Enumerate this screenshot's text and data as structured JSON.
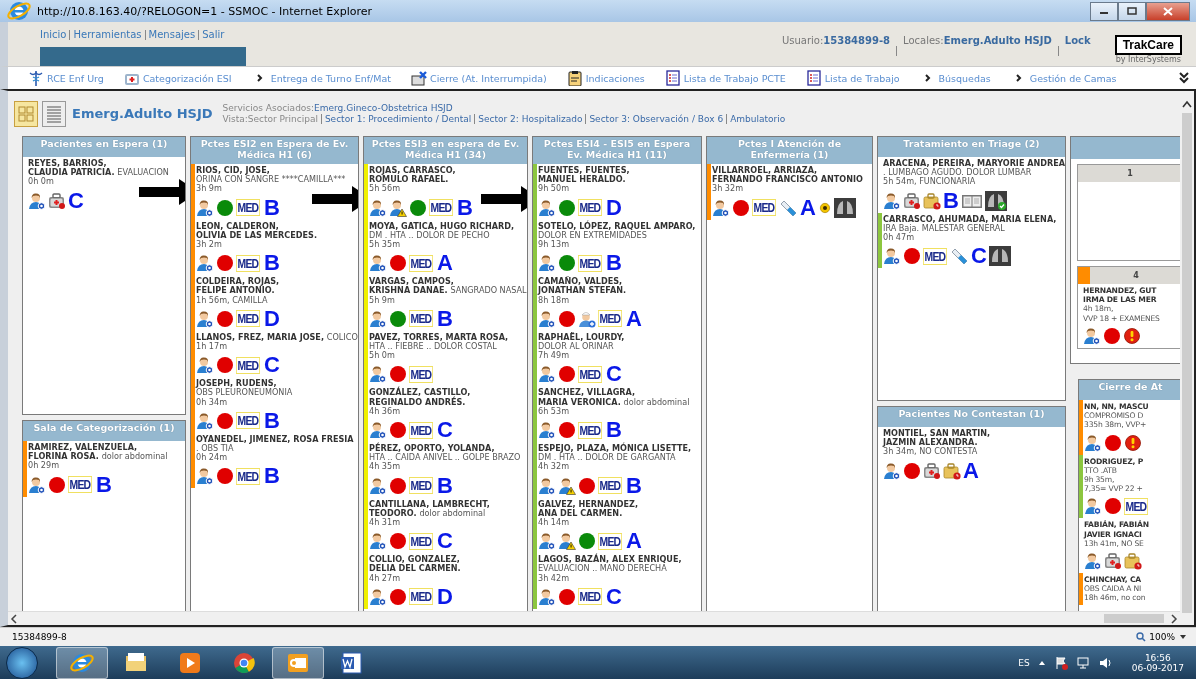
{
  "browser": {
    "title": "http://10.8.163.40/?RELOGON=1 - SSMOC - Internet Explorer",
    "status": "15384899-8",
    "zoom": "100%"
  },
  "header": {
    "links": [
      "Inicio",
      "Herramientas",
      "Mensajes",
      "Salir"
    ],
    "user_label": "Usuario:",
    "user": "15384899-8",
    "locale_label": "Locales:",
    "locale": "Emerg.Adulto HSJD",
    "lock": "Lock",
    "logo": "TrakCare",
    "logo_by": "by InterSystems"
  },
  "menu": [
    {
      "label": "RCE Enf Urg",
      "kind": "caduceus"
    },
    {
      "label": "Categorización ESI",
      "kind": "kit"
    },
    {
      "label": "Entrega de Turno Enf/Mat",
      "kind": "chevron"
    },
    {
      "label": "Cierre (At. Interrumpida)",
      "kind": "folder"
    },
    {
      "label": "Indicaciones",
      "kind": "clipboard"
    },
    {
      "label": "Lista de Trabajo PCTE",
      "kind": "list"
    },
    {
      "label": "Lista de Trabajo",
      "kind": "list"
    },
    {
      "label": "Búsquedas",
      "kind": "chevron"
    },
    {
      "label": "Gestión de Camas",
      "kind": "chevron"
    }
  ],
  "location": {
    "view_toggle": [
      {
        "kind": "grid",
        "selected": true
      },
      {
        "kind": "list",
        "selected": false
      }
    ],
    "title": "Emerg.Adulto HSJD",
    "services_label": "Servicios Asociados:",
    "services": "Emerg.Gineco-Obstetrica HSJD",
    "view_label": "Vista:Sector Principal",
    "sectors": [
      "Sector 1: Procedimiento / Dental",
      "Sector 2: Hospitalizado",
      "Sector 3: Observación / Box 6",
      "Ambulatorio"
    ]
  },
  "columns": [
    {
      "panels": [
        {
          "kind": "patients",
          "title": "Pacientes en Espera (1)",
          "arrow": true,
          "patients": [
            {
              "lines": [
                {
                  "kind": "name",
                  "text": "REYES, BARRIOS,"
                },
                {
                  "kind": "name",
                  "text": "CLAUDIA PATRICIA.",
                  "note": "EVALUACION"
                },
                {
                  "kind": "time",
                  "text": "0h 0m"
                }
              ],
              "icons": [
                {
                  "kind": "nurse"
                },
                {
                  "kind": "kit"
                },
                {
                  "kind": "grade",
                  "label": "C"
                }
              ]
            }
          ]
        },
        {
          "kind": "patients",
          "title": "Sala de Categorización (1)",
          "arrow": false,
          "patients": [
            {
              "color": "#ff8c00",
              "lines": [
                {
                  "kind": "name",
                  "text": "RAMIREZ, VALENZUELA,"
                },
                {
                  "kind": "name",
                  "text": "FLORINA ROSA.",
                  "note": "dolor abdominal"
                },
                {
                  "kind": "time",
                  "text": "0h 29m"
                }
              ],
              "icons": [
                {
                  "kind": "nurse"
                },
                {
                  "kind": "dot",
                  "color": "#e00000"
                },
                {
                  "kind": "med",
                  "label": "MED"
                },
                {
                  "kind": "grade",
                  "label": "B"
                }
              ]
            }
          ]
        }
      ]
    },
    {
      "panels": [
        {
          "kind": "patients",
          "title": "Pctes ESI2 en Espera de Ev. Médica H1 (6)",
          "arrow": true,
          "patients": [
            {
              "color": "#ff8c00",
              "lines": [
                {
                  "kind": "name",
                  "text": "RIOS, CID, JOSE,"
                },
                {
                  "kind": "note",
                  "text": "ORINA CON SANGRE ****CAMILLA***"
                },
                {
                  "kind": "time",
                  "text": "3h 9m"
                }
              ],
              "icons": [
                {
                  "kind": "nurse"
                },
                {
                  "kind": "dot",
                  "color": "#0a8a0a"
                },
                {
                  "kind": "med",
                  "label": "MED"
                },
                {
                  "kind": "grade",
                  "label": "B"
                }
              ]
            },
            {
              "color": "#ff8c00",
              "lines": [
                {
                  "kind": "name",
                  "text": "LEON, CALDERON,"
                },
                {
                  "kind": "name",
                  "text": "OLIVIA DE LAS MERCEDES."
                },
                {
                  "kind": "time",
                  "text": "3h 2m"
                }
              ],
              "icons": [
                {
                  "kind": "nurse"
                },
                {
                  "kind": "dot",
                  "color": "#e00000"
                },
                {
                  "kind": "med",
                  "label": "MED"
                },
                {
                  "kind": "grade",
                  "label": "B"
                }
              ]
            },
            {
              "color": "#ff8c00",
              "lines": [
                {
                  "kind": "name",
                  "text": "COLDEIRA, ROJAS,"
                },
                {
                  "kind": "name",
                  "text": "FELIPE ANTONIO."
                },
                {
                  "kind": "time",
                  "text": "1h 56m, CAMILLA"
                }
              ],
              "icons": [
                {
                  "kind": "nurse"
                },
                {
                  "kind": "dot",
                  "color": "#e00000"
                },
                {
                  "kind": "med",
                  "label": "MED"
                },
                {
                  "kind": "grade",
                  "label": "D"
                }
              ]
            },
            {
              "color": "#ff8c00",
              "lines": [
                {
                  "kind": "name",
                  "text": "LLANOS, FREZ, MARIA JOSE,",
                  "note": "COLICO"
                },
                {
                  "kind": "time",
                  "text": "1h 17m"
                }
              ],
              "icons": [
                {
                  "kind": "nurse"
                },
                {
                  "kind": "dot",
                  "color": "#e00000"
                },
                {
                  "kind": "med",
                  "label": "MED"
                },
                {
                  "kind": "grade",
                  "label": "C"
                }
              ]
            },
            {
              "color": "#ff8c00",
              "lines": [
                {
                  "kind": "name",
                  "text": "JOSEPH, RUDENS,"
                },
                {
                  "kind": "note",
                  "text": "OBS PLEURONEUMONIA"
                },
                {
                  "kind": "time",
                  "text": "0h 34m"
                }
              ],
              "icons": [
                {
                  "kind": "nurse"
                },
                {
                  "kind": "dot",
                  "color": "#e00000"
                },
                {
                  "kind": "med",
                  "label": "MED"
                },
                {
                  "kind": "grade",
                  "label": "B"
                }
              ]
            },
            {
              "color": "#ff8c00",
              "lines": [
                {
                  "kind": "name",
                  "text": "OYANEDEL, JIMENEZ, ROSA FRESIA"
                },
                {
                  "kind": "note",
                  "text": ". OBS TIA"
                },
                {
                  "kind": "time",
                  "text": "0h 24m"
                }
              ],
              "icons": [
                {
                  "kind": "nurse"
                },
                {
                  "kind": "dot",
                  "color": "#e00000"
                },
                {
                  "kind": "med",
                  "label": "MED"
                },
                {
                  "kind": "grade",
                  "label": "B"
                }
              ]
            }
          ]
        }
      ]
    },
    {
      "panels": [
        {
          "kind": "patients",
          "title": "Pctes ESI3 en espera de Ev. Médica H1 (34)",
          "arrow": true,
          "patients": [
            {
              "color": "#f0f000",
              "lines": [
                {
                  "kind": "name",
                  "text": "ROJAS, CARRASCO,"
                },
                {
                  "kind": "name",
                  "text": "ROMULO RAFAEL."
                },
                {
                  "kind": "time",
                  "text": "5h 56m"
                }
              ],
              "icons": [
                {
                  "kind": "nurse"
                },
                {
                  "kind": "warn"
                },
                {
                  "kind": "dot",
                  "color": "#0a8a0a"
                },
                {
                  "kind": "med",
                  "label": "MED"
                },
                {
                  "kind": "grade",
                  "label": "B"
                }
              ]
            },
            {
              "color": "#f0f000",
              "lines": [
                {
                  "kind": "name",
                  "text": "MOYA, GATICA, HUGO RICHARD,"
                },
                {
                  "kind": "note",
                  "text": "DM . HTA .. DOLOR DE PECHO"
                },
                {
                  "kind": "time",
                  "text": "5h 35m"
                }
              ],
              "icons": [
                {
                  "kind": "nurse"
                },
                {
                  "kind": "dot",
                  "color": "#e00000"
                },
                {
                  "kind": "med",
                  "label": "MED"
                },
                {
                  "kind": "grade",
                  "label": "A"
                }
              ]
            },
            {
              "color": "#f0f000",
              "lines": [
                {
                  "kind": "name",
                  "text": "VARGAS, CAMPOS,"
                },
                {
                  "kind": "name",
                  "text": "KRISHNA DANAE.",
                  "note": "SANGRADO NASAL"
                },
                {
                  "kind": "time",
                  "text": "5h 9m"
                }
              ],
              "icons": [
                {
                  "kind": "nurse"
                },
                {
                  "kind": "dot",
                  "color": "#0a8a0a"
                },
                {
                  "kind": "med",
                  "label": "MED"
                },
                {
                  "kind": "grade",
                  "label": "B"
                }
              ]
            },
            {
              "color": "#f0f000",
              "lines": [
                {
                  "kind": "name",
                  "text": "PAVEZ, TORRES, MARTA ROSA,"
                },
                {
                  "kind": "note",
                  "text": "HTA .. FIEBRE .. DOLOR COSTAL"
                },
                {
                  "kind": "time",
                  "text": "5h 0m"
                }
              ],
              "icons": [
                {
                  "kind": "nurse"
                },
                {
                  "kind": "dot",
                  "color": "#e00000"
                },
                {
                  "kind": "med",
                  "label": "MED"
                }
              ]
            },
            {
              "color": "#f0f000",
              "lines": [
                {
                  "kind": "name",
                  "text": "GONZÁLEZ, CASTILLO,"
                },
                {
                  "kind": "name",
                  "text": "REGINALDO ANDRÉS."
                },
                {
                  "kind": "time",
                  "text": "4h 36m"
                }
              ],
              "icons": [
                {
                  "kind": "nurse"
                },
                {
                  "kind": "dot",
                  "color": "#e00000"
                },
                {
                  "kind": "med",
                  "label": "MED"
                },
                {
                  "kind": "grade",
                  "label": "C"
                }
              ]
            },
            {
              "color": "#f0f000",
              "lines": [
                {
                  "kind": "name",
                  "text": "PÉREZ, OPORTO, YOLANDA,"
                },
                {
                  "kind": "note",
                  "text": "HTA .. CAIDA ANIVEL .. GOLPE BRAZO"
                },
                {
                  "kind": "time",
                  "text": "4h 35m"
                }
              ],
              "icons": [
                {
                  "kind": "nurse"
                },
                {
                  "kind": "dot",
                  "color": "#e00000"
                },
                {
                  "kind": "med",
                  "label": "MED"
                },
                {
                  "kind": "grade",
                  "label": "B"
                }
              ]
            },
            {
              "color": "#f0f000",
              "lines": [
                {
                  "kind": "name",
                  "text": "CANTILLANA, LAMBRECHT,"
                },
                {
                  "kind": "name",
                  "text": "TEODORO.",
                  "note": "dolor abdominal"
                },
                {
                  "kind": "time",
                  "text": "4h 31m"
                }
              ],
              "icons": [
                {
                  "kind": "nurse"
                },
                {
                  "kind": "dot",
                  "color": "#e00000"
                },
                {
                  "kind": "med",
                  "label": "MED"
                },
                {
                  "kind": "grade",
                  "label": "C"
                }
              ]
            },
            {
              "color": "#f0f000",
              "lines": [
                {
                  "kind": "name",
                  "text": "COLLIO, GONZALEZ,"
                },
                {
                  "kind": "name",
                  "text": "DELIA DEL CARMEN."
                },
                {
                  "kind": "time",
                  "text": "4h 27m"
                }
              ],
              "icons": [
                {
                  "kind": "nurse"
                },
                {
                  "kind": "dot",
                  "color": "#e00000"
                },
                {
                  "kind": "med",
                  "label": "MED"
                },
                {
                  "kind": "grade",
                  "label": "D"
                }
              ]
            }
          ]
        }
      ]
    },
    {
      "panels": [
        {
          "kind": "patients",
          "title": "Pctes ESI4 - ESI5 en Espera Ev. Médica H1 (11)",
          "arrow": false,
          "patients": [
            {
              "color": "#8cc63f",
              "lines": [
                {
                  "kind": "name",
                  "text": "FUENTES, FUENTES,"
                },
                {
                  "kind": "name",
                  "text": "MANUEL HERALDO."
                },
                {
                  "kind": "time",
                  "text": "9h 50m"
                }
              ],
              "icons": [
                {
                  "kind": "nurse"
                },
                {
                  "kind": "dot",
                  "color": "#0a8a0a"
                },
                {
                  "kind": "med",
                  "label": "MED"
                },
                {
                  "kind": "grade",
                  "label": "D"
                }
              ]
            },
            {
              "color": "#8cc63f",
              "lines": [
                {
                  "kind": "name",
                  "text": "SOTELO, LÓPEZ, RAQUEL AMPARO,"
                },
                {
                  "kind": "note",
                  "text": "DOLOR EN EXTREMIDADES"
                },
                {
                  "kind": "time",
                  "text": "9h 13m"
                }
              ],
              "icons": [
                {
                  "kind": "nurse"
                },
                {
                  "kind": "dot",
                  "color": "#0a8a0a"
                },
                {
                  "kind": "med",
                  "label": "MED"
                },
                {
                  "kind": "grade",
                  "label": "B"
                }
              ]
            },
            {
              "color": "#8cc63f",
              "lines": [
                {
                  "kind": "name",
                  "text": "CAMAÑO, VALDES,"
                },
                {
                  "kind": "name",
                  "text": "JONATHAN STEFAN."
                },
                {
                  "kind": "time",
                  "text": "8h 18m"
                }
              ],
              "icons": [
                {
                  "kind": "nurse"
                },
                {
                  "kind": "dot",
                  "color": "#e00000"
                },
                {
                  "kind": "doctor"
                },
                {
                  "kind": "med",
                  "label": "MED"
                },
                {
                  "kind": "grade",
                  "label": "A"
                }
              ]
            },
            {
              "color": "#8cc63f",
              "lines": [
                {
                  "kind": "name",
                  "text": "RAPHAËL, LOURDY,"
                },
                {
                  "kind": "note",
                  "text": "DOLOR AL ORINAR"
                },
                {
                  "kind": "time",
                  "text": "7h 49m"
                }
              ],
              "icons": [
                {
                  "kind": "nurse"
                },
                {
                  "kind": "dot",
                  "color": "#e00000"
                },
                {
                  "kind": "med",
                  "label": "MED"
                },
                {
                  "kind": "grade",
                  "label": "C"
                }
              ]
            },
            {
              "color": "#8cc63f",
              "lines": [
                {
                  "kind": "name",
                  "text": "SANCHEZ, VILLAGRA,"
                },
                {
                  "kind": "name",
                  "text": "MARIA VERONICA.",
                  "note": "dolor abdominal"
                },
                {
                  "kind": "time",
                  "text": "6h 53m"
                }
              ],
              "icons": [
                {
                  "kind": "nurse"
                },
                {
                  "kind": "dot",
                  "color": "#e00000"
                },
                {
                  "kind": "med",
                  "label": "MED"
                },
                {
                  "kind": "grade",
                  "label": "B"
                }
              ]
            },
            {
              "color": "#8cc63f",
              "lines": [
                {
                  "kind": "name",
                  "text": "ESPEJO, PLAZA, MÓNICA LISETTE,"
                },
                {
                  "kind": "note",
                  "text": "DM . HTA .. DOLOR DE GARGANTA"
                },
                {
                  "kind": "time",
                  "text": "4h 32m"
                }
              ],
              "icons": [
                {
                  "kind": "nurse"
                },
                {
                  "kind": "warn"
                },
                {
                  "kind": "dot",
                  "color": "#e00000"
                },
                {
                  "kind": "med",
                  "label": "MED"
                },
                {
                  "kind": "grade",
                  "label": "B"
                }
              ]
            },
            {
              "color": "#8cc63f",
              "lines": [
                {
                  "kind": "name",
                  "text": "GALVEZ, HERNANDEZ,"
                },
                {
                  "kind": "name",
                  "text": "ANA DEL CARMEN."
                },
                {
                  "kind": "time",
                  "text": "4h 14m"
                }
              ],
              "icons": [
                {
                  "kind": "nurse"
                },
                {
                  "kind": "warn"
                },
                {
                  "kind": "dot",
                  "color": "#0a8a0a"
                },
                {
                  "kind": "med",
                  "label": "MED"
                },
                {
                  "kind": "grade",
                  "label": "A"
                }
              ]
            },
            {
              "color": "#8cc63f",
              "lines": [
                {
                  "kind": "name",
                  "text": "LAGOS, BAZÁN, ALEX ENRIQUE,"
                },
                {
                  "kind": "note",
                  "text": "EVALUACION .. MANO DERECHA"
                },
                {
                  "kind": "time",
                  "text": "3h 42m"
                }
              ],
              "icons": [
                {
                  "kind": "nurse"
                },
                {
                  "kind": "dot",
                  "color": "#e00000"
                },
                {
                  "kind": "med",
                  "label": "MED"
                },
                {
                  "kind": "grade",
                  "label": "C"
                }
              ]
            }
          ]
        }
      ]
    },
    {
      "panels": [
        {
          "kind": "patients",
          "title": "Pctes I Atención de Enfermería (1)",
          "arrow": false,
          "patients": [
            {
              "color": "#ff8c00",
              "lines": [
                {
                  "kind": "name",
                  "text": "VILLARROEL, ARRIAZA,"
                },
                {
                  "kind": "name",
                  "text": "FERNANDO FRANCISCO ANTONIO"
                },
                {
                  "kind": "time",
                  "text": "3h 32m"
                }
              ],
              "icons": [
                {
                  "kind": "nurse"
                },
                {
                  "kind": "dot",
                  "color": "#e00000"
                },
                {
                  "kind": "med",
                  "label": "MED"
                },
                {
                  "kind": "syringe"
                },
                {
                  "kind": "grade",
                  "label": "A"
                },
                {
                  "kind": "sun"
                },
                {
                  "kind": "xray"
                }
              ]
            }
          ]
        }
      ]
    },
    {
      "panels": [
        {
          "kind": "patients",
          "title": "Tratamiento en Triage (2)",
          "arrow": false,
          "patients": [
            {
              "lines": [
                {
                  "kind": "name",
                  "text": "ARACENA, PEREIRA, MARYORIE ANDREA"
                },
                {
                  "kind": "note",
                  "text": ". LUMBAGO AGUDO. DOLOR LUMBAR"
                },
                {
                  "kind": "time",
                  "text": "5h 54m, FUNCIONARIA"
                }
              ],
              "icons": [
                {
                  "kind": "nurse"
                },
                {
                  "kind": "kit"
                },
                {
                  "kind": "bag"
                },
                {
                  "kind": "grade",
                  "label": "B"
                },
                {
                  "kind": "book"
                },
                {
                  "kind": "xray-ok"
                }
              ]
            },
            {
              "color": "#8cc63f",
              "lines": [
                {
                  "kind": "name",
                  "text": "CARRASCO, AHUMADA, MARIA ELENA,"
                },
                {
                  "kind": "note",
                  "text": "IRA Baja. MALESTAR GENERAL"
                },
                {
                  "kind": "time",
                  "text": "0h 47m"
                }
              ],
              "icons": [
                {
                  "kind": "nurse"
                },
                {
                  "kind": "dot",
                  "color": "#e00000"
                },
                {
                  "kind": "med",
                  "label": "MED"
                },
                {
                  "kind": "syringe"
                },
                {
                  "kind": "grade",
                  "label": "C"
                },
                {
                  "kind": "xray"
                }
              ]
            }
          ]
        },
        {
          "kind": "patients",
          "title": "Pacientes No Contestan (1)",
          "arrow": false,
          "patients": [
            {
              "lines": [
                {
                  "kind": "name",
                  "text": "MONTIEL, SAN MARTIN,"
                },
                {
                  "kind": "name",
                  "text": "JAZMIN ALEXANDRA."
                },
                {
                  "kind": "time",
                  "text": "3h 34m, NO CONTESTA"
                }
              ],
              "icons": [
                {
                  "kind": "nurse"
                },
                {
                  "kind": "dot",
                  "color": "#e00000"
                },
                {
                  "kind": "kit"
                },
                {
                  "kind": "bag"
                },
                {
                  "kind": "grade",
                  "label": "A"
                }
              ]
            }
          ]
        }
      ]
    },
    {
      "panels": [
        {
          "kind": "beds",
          "boxes": [
            {
              "label": "1"
            },
            {
              "label": "4",
              "color": "#ff8c00",
              "patients": [
                {
                  "lines": [
                    {
                      "kind": "name",
                      "text": "HERNANDEZ, GUT"
                    },
                    {
                      "kind": "name",
                      "text": "IRMA DE LAS MER"
                    },
                    {
                      "kind": "time",
                      "text": "4h 18m,"
                    },
                    {
                      "kind": "time",
                      "text": "VVP 18 + EXAMENES"
                    }
                  ],
                  "icons": [
                    {
                      "kind": "nurse"
                    },
                    {
                      "kind": "dot",
                      "color": "#e00000"
                    },
                    {
                      "kind": "alert"
                    }
                  ]
                }
              ]
            }
          ]
        },
        {
          "kind": "patients",
          "title": "Cierre de At",
          "arrow": false,
          "patients": [
            {
              "color": "#ff8c00",
              "lines": [
                {
                  "kind": "name",
                  "text": "NN, NN, MASCU"
                },
                {
                  "kind": "note",
                  "text": "COMPROMISO D"
                },
                {
                  "kind": "time",
                  "text": "335h 38m, VVP+"
                }
              ],
              "icons": [
                {
                  "kind": "nurse"
                },
                {
                  "kind": "dot",
                  "color": "#e00000"
                },
                {
                  "kind": "alert"
                }
              ]
            },
            {
              "color": "#8cc63f",
              "lines": [
                {
                  "kind": "name",
                  "text": "RODRIGUEZ, P"
                },
                {
                  "kind": "note",
                  "text": "TTO .ATB"
                },
                {
                  "kind": "time",
                  "text": "9h 35m,"
                },
                {
                  "kind": "time",
                  "text": "7,35= VVP 22 +"
                }
              ],
              "icons": [
                {
                  "kind": "nurse"
                },
                {
                  "kind": "dot",
                  "color": "#e00000"
                },
                {
                  "kind": "med",
                  "label": "MED"
                }
              ]
            },
            {
              "lines": [
                {
                  "kind": "name",
                  "text": "FABIÁN, FABIÁN"
                },
                {
                  "kind": "name",
                  "text": "JAVIER IGNACI"
                },
                {
                  "kind": "time",
                  "text": "13h 41m, NO SE"
                }
              ],
              "icons": [
                {
                  "kind": "nurse"
                },
                {
                  "kind": "kit"
                },
                {
                  "kind": "bag"
                }
              ]
            },
            {
              "color": "#ff8c00",
              "lines": [
                {
                  "kind": "name",
                  "text": "CHINCHAY, CA"
                },
                {
                  "kind": "note",
                  "text": "OBS CAIDA A NI"
                },
                {
                  "kind": "time",
                  "text": "18h 46m, no con"
                }
              ]
            }
          ]
        }
      ]
    }
  ],
  "taskbar": {
    "apps": [
      {
        "kind": "ie",
        "selected": true
      },
      {
        "kind": "folder",
        "selected": false
      },
      {
        "kind": "media",
        "selected": false
      },
      {
        "kind": "chrome",
        "selected": false
      },
      {
        "kind": "outlook",
        "selected": true
      },
      {
        "kind": "word",
        "selected": false
      }
    ],
    "language": "ES",
    "time": "16:56",
    "date": "06-09-2017"
  }
}
